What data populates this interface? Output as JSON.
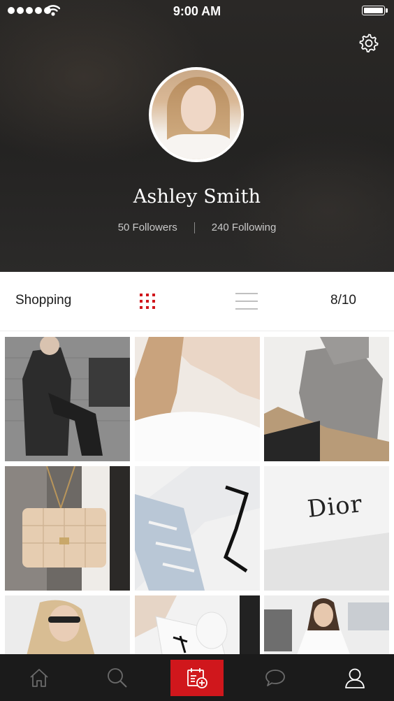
{
  "status_bar": {
    "time": "9:00 AM",
    "signal_dots": 5
  },
  "header": {
    "settings_icon": "gear-icon",
    "profile_name": "Ashley Smith",
    "followers": "50 Followers",
    "following": "240 Following"
  },
  "toolbar": {
    "section_title": "Shopping",
    "grid_view_icon": "grid-icon",
    "list_view_icon": "list-icon",
    "page_count": "8/10"
  },
  "photos": {
    "dior_text": "Dior"
  },
  "tab_bar": {
    "items": [
      {
        "name": "home",
        "icon": "home-icon"
      },
      {
        "name": "search",
        "icon": "search-icon"
      },
      {
        "name": "add",
        "icon": "calendar-add-icon",
        "active": true
      },
      {
        "name": "messages",
        "icon": "chat-bubble-icon"
      },
      {
        "name": "profile",
        "icon": "user-icon"
      }
    ]
  },
  "colors": {
    "accent": "#d0171c",
    "header_bg": "#262524",
    "tab_bar_bg": "#1b1b1b"
  }
}
